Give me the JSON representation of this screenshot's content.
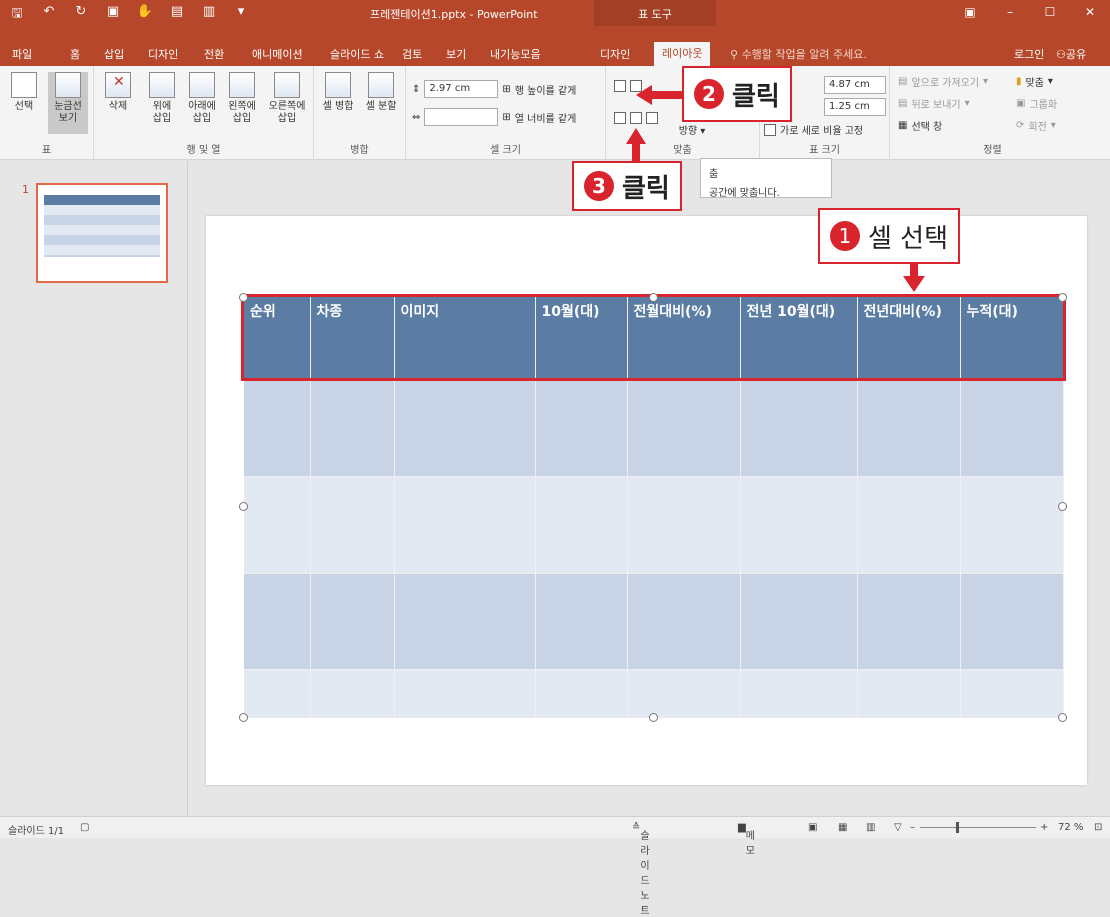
{
  "window": {
    "title": "프레젠테이션1.pptx - PowerPoint",
    "context_tab": "표 도구"
  },
  "tabs": [
    "파일",
    "홈",
    "삽입",
    "디자인",
    "전환",
    "애니메이션",
    "슬라이드 쇼",
    "검토",
    "보기",
    "내기능모음",
    "디자인",
    "레이아웃"
  ],
  "active_tab": "레이아웃",
  "tell_me": "수행할 작업을 알려 주세요.",
  "login": "로그인",
  "share": "공유",
  "ribbon": {
    "table_group": {
      "label": "표",
      "select": "선택",
      "gridlines": "눈금선\n보기"
    },
    "rows_cols": {
      "label": "행 및 열",
      "delete": "삭제",
      "above": "위에\n삽입",
      "below": "아래에\n삽입",
      "left": "왼쪽에\n삽입",
      "right": "오른쪽에\n삽입"
    },
    "merge": {
      "label": "병합",
      "merge_cells": "셀 병합",
      "split_cells": "셀 분할"
    },
    "cell_size": {
      "label": "셀 크기",
      "height": "2.97 cm",
      "width": "",
      "dist_rows": "행 높이를 같게",
      "dist_cols": "열 너비를 같게"
    },
    "alignment": {
      "label": "맞춤",
      "direction": "방향"
    },
    "table_size": {
      "label": "표 크기",
      "height": "4.87 cm",
      "width": "1.25 cm",
      "lock": "가로 세로 비율 고정"
    },
    "arrange": {
      "label": "정렬",
      "forward": "앞으로 가져오기",
      "backward": "뒤로 보내기",
      "selection_pane": "선택 창",
      "align": "맞춤",
      "group": "그룹화",
      "rotate": "회전"
    }
  },
  "tooltip": {
    "line1": "춤",
    "line2": "공간에 맞춥니다."
  },
  "callouts": {
    "c1": {
      "num": "1",
      "text": "셀 선택"
    },
    "c2": {
      "num": "2",
      "text": "클릭"
    },
    "c3": {
      "num": "3",
      "text": "클릭"
    }
  },
  "thumbnail": {
    "number": "1"
  },
  "table": {
    "headers": [
      "순위",
      "차종",
      "이미지",
      "10월(대)",
      "전월대비(%)",
      "전년 10월(대)",
      "전년대비(%)",
      "누적(대)"
    ]
  },
  "status": {
    "slide": "슬라이드 1/1",
    "notes": "슬라이드 노트",
    "comments": "메모",
    "zoom": "72 %"
  },
  "colors": {
    "accent": "#b7472a",
    "callout": "#d9232d",
    "header": "#5b7ca3"
  }
}
